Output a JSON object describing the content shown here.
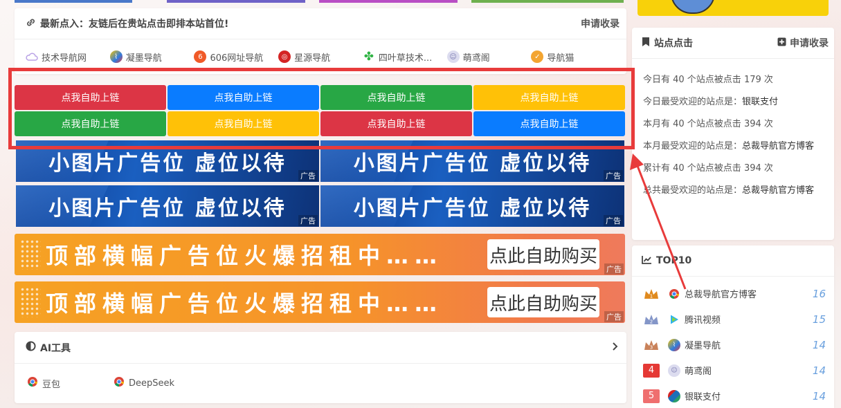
{
  "latest": {
    "title": "最新点入：友链后在贵站点击即排本站首位!",
    "action": "申请收录",
    "links": [
      {
        "label": "技术导航网",
        "icon": "cloud-icon",
        "color": "#b9a2e6"
      },
      {
        "label": "凝墨导航",
        "icon": "ink-logo-icon",
        "color": "#2f7be0"
      },
      {
        "label": "606网址导航",
        "icon": "six-logo-icon",
        "color": "#f05a28"
      },
      {
        "label": "星源导航",
        "icon": "seal-logo-icon",
        "color": "#d42424"
      },
      {
        "label": "四叶草技术...",
        "icon": "clover-icon",
        "color": "#2fb344"
      },
      {
        "label": "萌鸢阁",
        "icon": "anime-avatar-icon",
        "color": "#c9c9e8"
      },
      {
        "label": "导航猫",
        "icon": "cat-badge-icon",
        "color": "#f3a531"
      }
    ]
  },
  "selflinks": {
    "buttons": [
      {
        "label": "点我自助上链",
        "color": "#dc3545"
      },
      {
        "label": "点我自助上链",
        "color": "#0a7cff"
      },
      {
        "label": "点我自助上链",
        "color": "#28a745"
      },
      {
        "label": "点我自助上链",
        "color": "#ffc107"
      },
      {
        "label": "点我自助上链",
        "color": "#28a745"
      },
      {
        "label": "点我自助上链",
        "color": "#ffc107"
      },
      {
        "label": "点我自助上链",
        "color": "#dc3545"
      },
      {
        "label": "点我自助上链",
        "color": "#0a7cff"
      }
    ]
  },
  "ads": {
    "small_text": "小图片广告位 虚位以待",
    "tag": "广告",
    "wide_text": "顶部横幅广告位火爆招租中……",
    "wide_button": "点此自助购买"
  },
  "aitools": {
    "title": "AI工具",
    "items": [
      {
        "label": "豆包"
      },
      {
        "label": "DeepSeek"
      }
    ]
  },
  "clicks": {
    "title": "站点点击",
    "action": "申请收录",
    "stats": [
      {
        "prefix": "今日有 40 个站点被点击 179 次",
        "value": ""
      },
      {
        "prefix": "今日最受欢迎的站点是：",
        "value": "银联支付"
      },
      {
        "prefix": "本月有 40 个站点被点击 394 次",
        "value": ""
      },
      {
        "prefix": "本月最受欢迎的站点是：",
        "value": "总裁导航官方博客"
      },
      {
        "prefix": "累计有 40 个站点被点击 394 次",
        "value": ""
      },
      {
        "prefix": "总共最受欢迎的站点是：",
        "value": "总裁导航官方博客"
      }
    ]
  },
  "top10": {
    "title": "TOP10",
    "items": [
      {
        "rank": "",
        "name": "总裁导航官方博客",
        "count": "16",
        "crown": "#e08a1e",
        "icon_color": "#4285f4"
      },
      {
        "rank": "",
        "name": "腾讯视频",
        "count": "15",
        "crown": "#7e8fc4",
        "icon_color": "#29b6f6"
      },
      {
        "rank": "",
        "name": "凝墨导航",
        "count": "14",
        "crown": "#c9825a",
        "icon_color": "#2f7be0"
      },
      {
        "rank": "4",
        "name": "萌鸢阁",
        "count": "14",
        "badge": "#e53935",
        "icon_color": "#c9c9e8"
      },
      {
        "rank": "5",
        "name": "银联支付",
        "count": "14",
        "badge": "#ef6f6f",
        "icon_color": "#1d6fb8"
      }
    ]
  },
  "colors": {
    "highlight": "#e83b3b",
    "accent_blue": "#6aa0de"
  }
}
